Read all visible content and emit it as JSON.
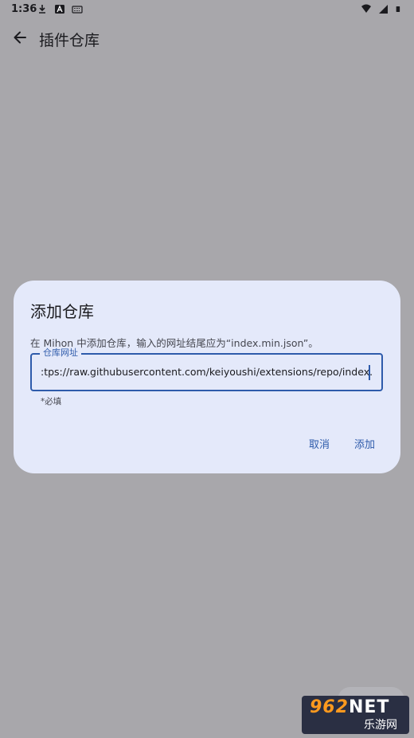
{
  "status_bar": {
    "time": "1:36",
    "left_icons": [
      "download-icon",
      "a-badge-icon",
      "keyboard-icon"
    ],
    "right_icons": [
      "wifi-icon",
      "signal-icon",
      "battery-icon"
    ]
  },
  "app_bar": {
    "title": "插件仓库",
    "back_icon": "arrow-back-icon"
  },
  "dialog": {
    "title": "添加仓库",
    "description": "在 Mihon 中添加仓库，输入的网址结尾应为“index.min.json”。",
    "field": {
      "label": "仓库网址",
      "value": ":tps://raw.githubusercontent.com/keiyoushi/extensions/repo/index.min.json",
      "supporting_text": "*必填"
    },
    "cancel_label": "取消",
    "add_label": "添加"
  },
  "watermark": {
    "top_number": "962",
    "top_suffix": "NET",
    "bottom_text": "乐游网"
  },
  "colors": {
    "scrim": "#a8a7ab",
    "dialog_bg": "#e4e9fa",
    "primary": "#2e5bab"
  }
}
